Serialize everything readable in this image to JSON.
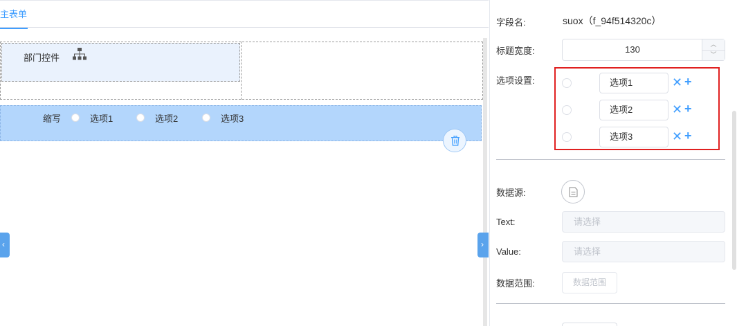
{
  "tabs": {
    "active_label": "主表单"
  },
  "canvas": {
    "dept_control_label": "部门控件",
    "radio_field": {
      "label": "缩写",
      "options": [
        "选项1",
        "选项2",
        "选项3"
      ]
    }
  },
  "icons": {
    "org": "org-chart-icon",
    "trash": "trash-icon",
    "datasource": "document-icon",
    "collapse_left": "chevron-left-icon",
    "collapse_right": "chevron-right-icon"
  },
  "props": {
    "field_name_label": "字段名:",
    "field_name_value": "suox（f_94f514320c）",
    "title_width_label": "标题宽度:",
    "title_width_value": "130",
    "options_label": "选项设置:",
    "options": [
      {
        "value": "选项1"
      },
      {
        "value": "选项2"
      },
      {
        "value": "选项3"
      }
    ],
    "datasource_label": "数据源:",
    "text_label": "Text:",
    "text_placeholder": "请选择",
    "value_label": "Value:",
    "value_placeholder": "请选择",
    "range_label": "数据范围:",
    "range_button": "数据范围"
  },
  "colors": {
    "accent": "#409eff",
    "selected_row": "#b3d6fc",
    "highlight_box": "#e02020"
  }
}
